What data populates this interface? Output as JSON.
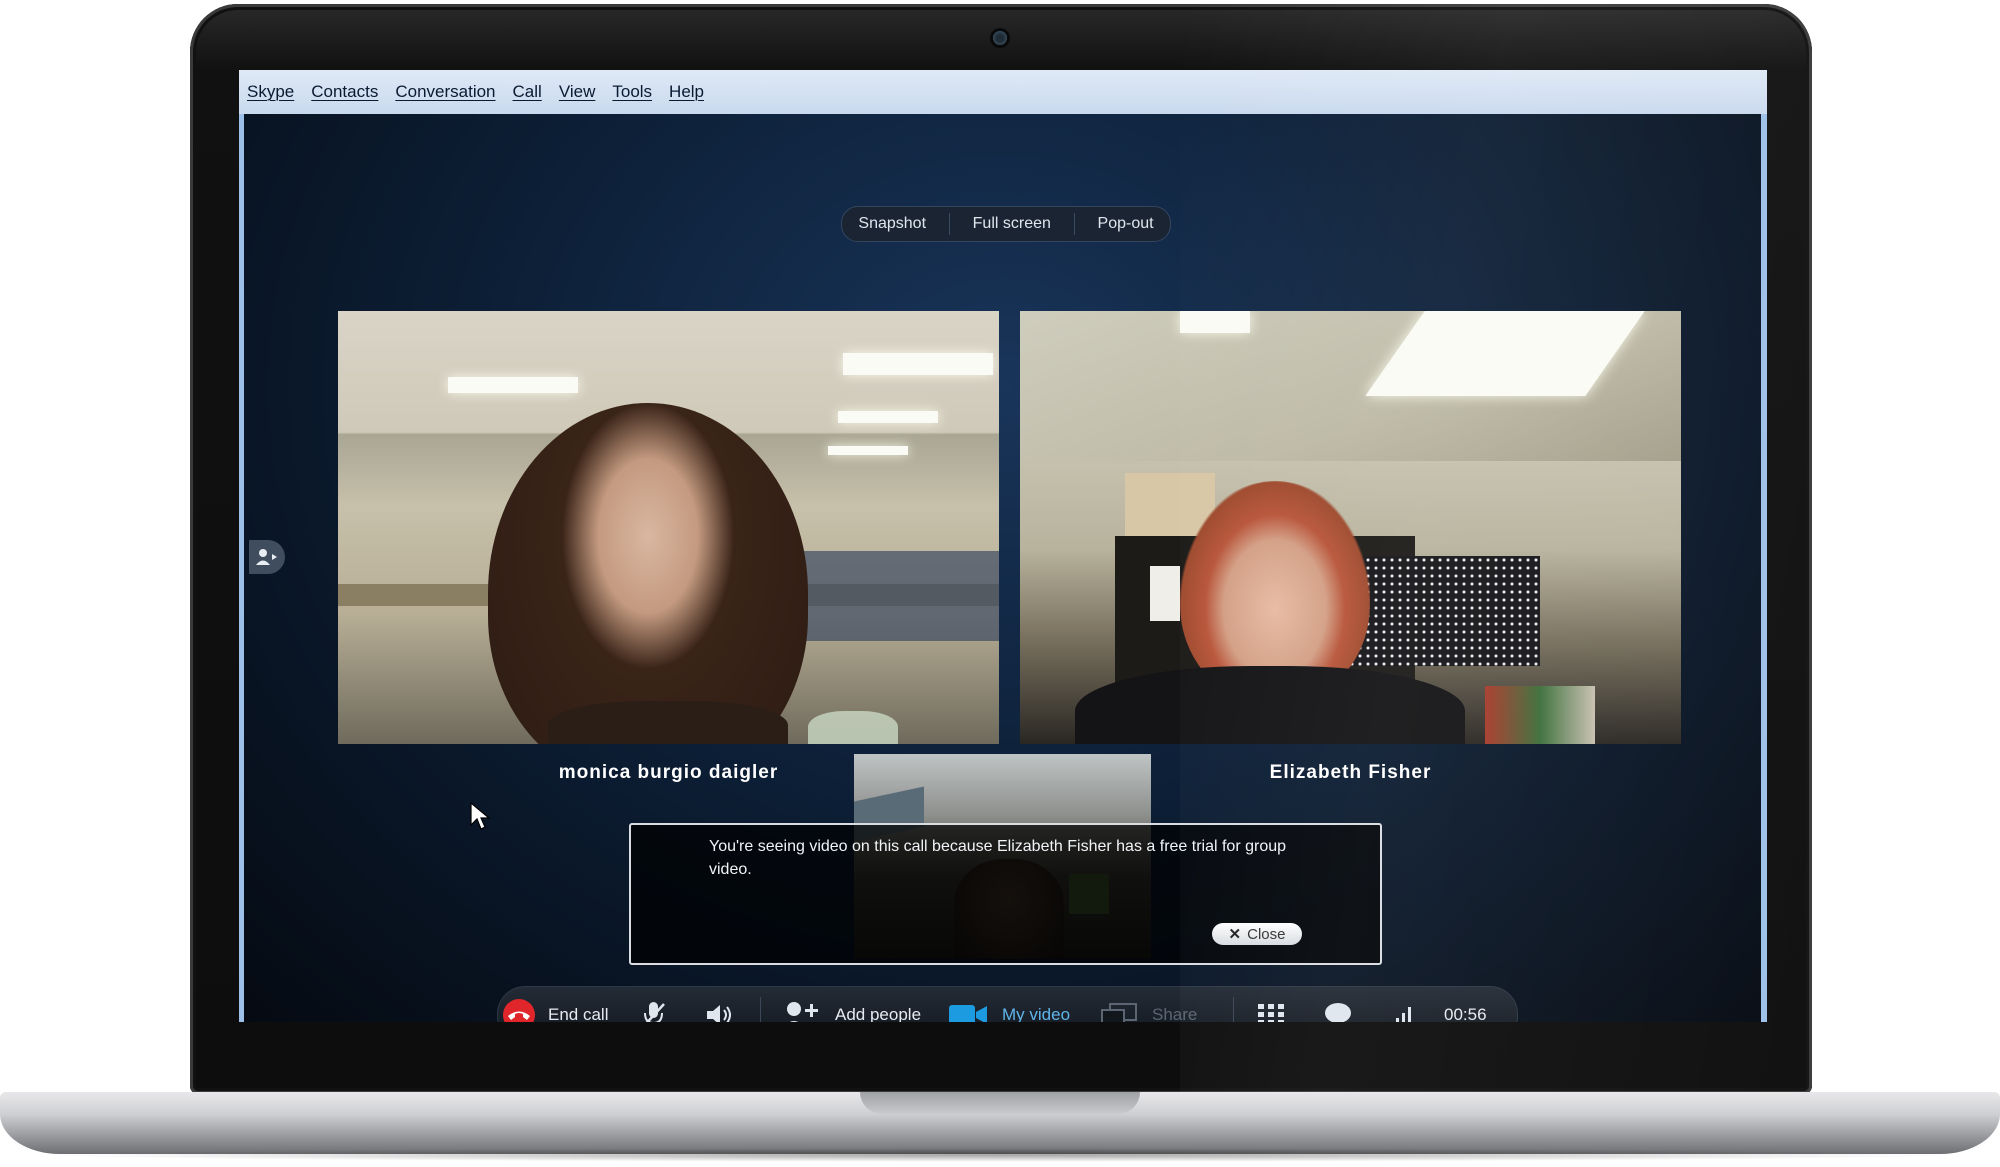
{
  "menu": [
    "Skype",
    "Contacts",
    "Conversation",
    "Call",
    "View",
    "Tools",
    "Help"
  ],
  "video_toolbar": {
    "snapshot": "Snapshot",
    "full_screen": "Full screen",
    "pop_out": "Pop-out"
  },
  "participants": [
    {
      "name": "monica burgio daigler"
    },
    {
      "name": "Elizabeth Fisher"
    }
  ],
  "notice": {
    "text": "You're seeing video on this call because Elizabeth Fisher has a free trial for group video.",
    "close_label": "Close"
  },
  "call_controls": {
    "end_call": "End call",
    "add_people": "Add people",
    "my_video": "My video",
    "share": "Share",
    "timer": "00:56"
  },
  "colors": {
    "menubar": "#c9d9ee",
    "end_call_red": "#e0262b",
    "video_blue": "#1d9be0"
  }
}
